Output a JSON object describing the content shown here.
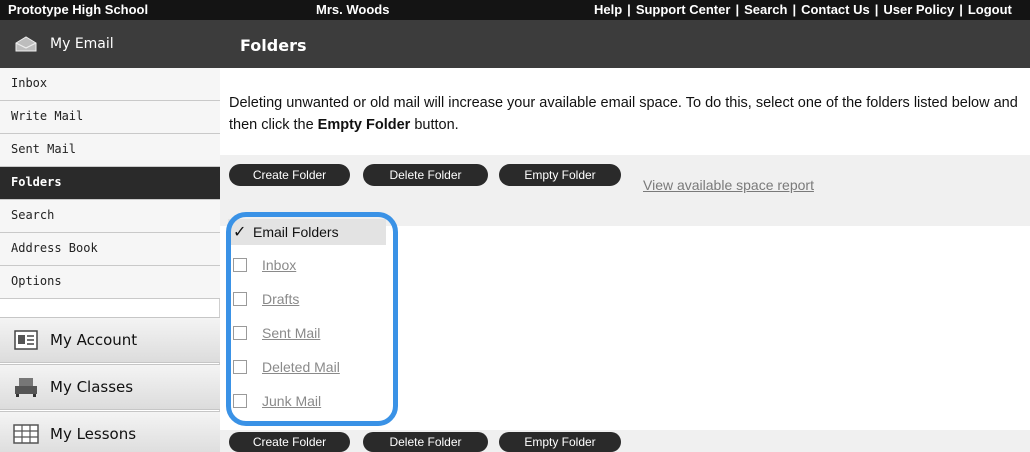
{
  "topbar": {
    "school": "Prototype High School",
    "teacher": "Mrs. Woods",
    "links": [
      "Help",
      "Support Center",
      "Search",
      "Contact Us",
      "User Policy",
      "Logout"
    ],
    "separator": "|"
  },
  "sidebar": {
    "my_email": "My Email",
    "items": [
      "Inbox",
      "Write Mail",
      "Sent Mail",
      "Folders",
      "Search",
      "Address Book",
      "Options"
    ],
    "active_item": "Folders",
    "my_account": "My Account",
    "my_classes": "My Classes",
    "my_lessons": "My Lessons"
  },
  "content": {
    "title": "Folders",
    "intro_part1": "Deleting unwanted or old mail will increase your available email space. To do this, select one of the folders listed below and then click the ",
    "intro_bold": "Empty Folder",
    "intro_part2": " button."
  },
  "toolbar": {
    "create": "Create Folder",
    "delete": "Delete Folder",
    "empty": "Empty Folder",
    "space_report": "View available space report"
  },
  "folders": {
    "header": "Email Folders",
    "check_mark": "✓",
    "items": [
      "Inbox",
      "Drafts",
      "Sent Mail",
      "Deleted Mail",
      "Junk Mail"
    ]
  },
  "colors": {
    "dark_bar": "#141414",
    "panel_dark": "#3c3c3c",
    "highlight": "#3a92e6",
    "link_gray": "#7a7a7a"
  }
}
